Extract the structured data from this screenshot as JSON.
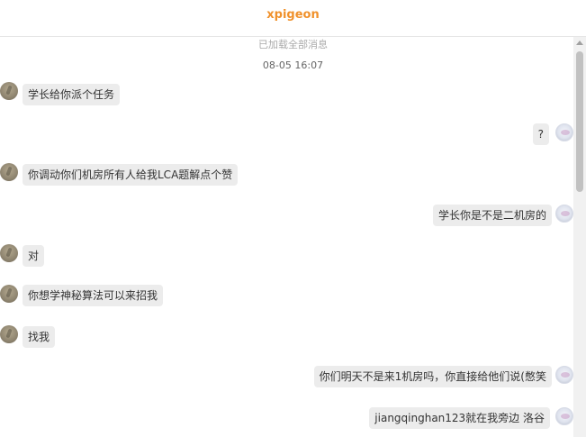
{
  "header": {
    "title": "xpigeon"
  },
  "chat": {
    "loaded_notice": "已加载全部消息",
    "timestamp": "08-05 16:07",
    "messages": [
      {
        "side": "left",
        "text": "学长给你派个任务"
      },
      {
        "side": "right",
        "text": "?"
      },
      {
        "side": "left",
        "text": "你调动你们机房所有人给我LCA题解点个赞"
      },
      {
        "side": "right",
        "text": "学长你是不是二机房的"
      },
      {
        "side": "left",
        "text": "对"
      },
      {
        "side": "left",
        "text": "你想学神秘算法可以来招我"
      },
      {
        "side": "left",
        "text": "找我"
      },
      {
        "side": "right",
        "text": "你们明天不是来1机房吗，你直接给他们说(憋笑"
      },
      {
        "side": "right",
        "text": "jiangqinghan123就在我旁边 洛谷"
      }
    ]
  },
  "colors": {
    "title": "#f0912b",
    "bubble": "#ececec",
    "divider": "#e6e6e6"
  }
}
